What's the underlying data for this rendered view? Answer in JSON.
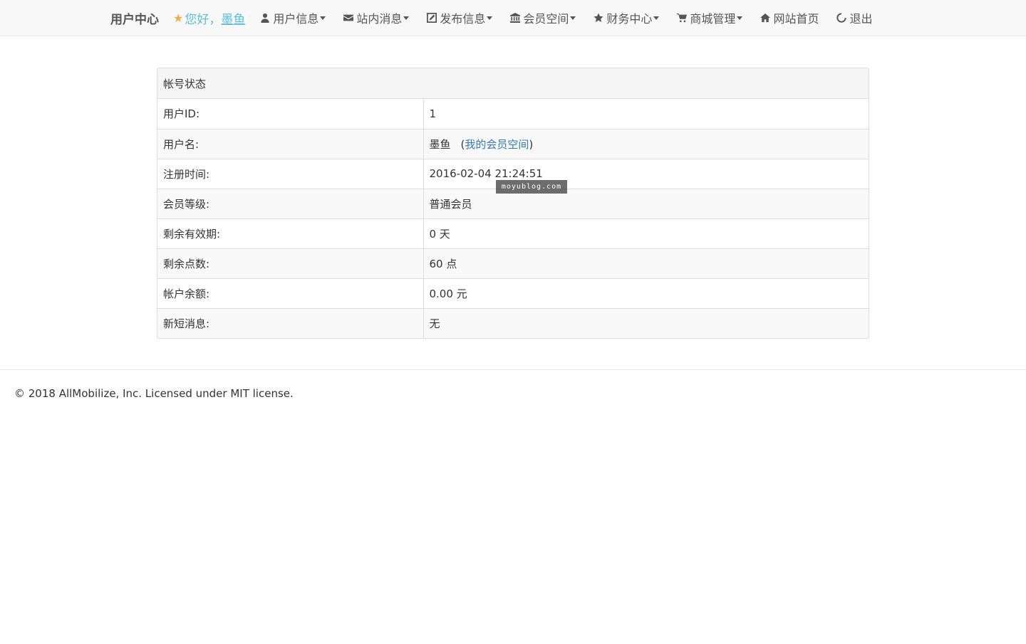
{
  "nav": {
    "brand": "用户中心",
    "greeting": "您好，",
    "username": "墨鱼",
    "items": [
      {
        "label": "用户信息",
        "icon": "user-icon",
        "dropdown": true
      },
      {
        "label": "站内消息",
        "icon": "envelope-icon",
        "dropdown": true
      },
      {
        "label": "发布信息",
        "icon": "edit-icon",
        "dropdown": true
      },
      {
        "label": "会员空间",
        "icon": "bank-icon",
        "dropdown": true
      },
      {
        "label": "财务中心",
        "icon": "star-icon",
        "dropdown": true
      },
      {
        "label": "商城管理",
        "icon": "cart-icon",
        "dropdown": true
      },
      {
        "label": "网站首页",
        "icon": "home-icon",
        "dropdown": false
      },
      {
        "label": "退出",
        "icon": "power-icon",
        "dropdown": false
      }
    ]
  },
  "panel": {
    "title": "帐号状态",
    "rows": [
      {
        "label": "用户ID:",
        "value": "1"
      },
      {
        "label": "用户名:",
        "value": "墨鱼",
        "link_open": "(",
        "link": "我的会员空间",
        "link_close": ")"
      },
      {
        "label": "注册时间:",
        "value": "2016-02-04 21:24:51"
      },
      {
        "label": "会员等级:",
        "value": "普通会员"
      },
      {
        "label": "剩余有效期:",
        "value": "0 天"
      },
      {
        "label": "剩余点数:",
        "value": "60 点"
      },
      {
        "label": "帐户余额:",
        "value": "0.00 元"
      },
      {
        "label": "新短消息:",
        "value": "无"
      }
    ]
  },
  "watermark": "moyublog.com",
  "footer": {
    "text": "© 2018 AllMobilize, Inc. Licensed under MIT license."
  },
  "colors": {
    "accent": "#5bc0de",
    "star": "#f0ad4e",
    "link": "#337ab7"
  }
}
